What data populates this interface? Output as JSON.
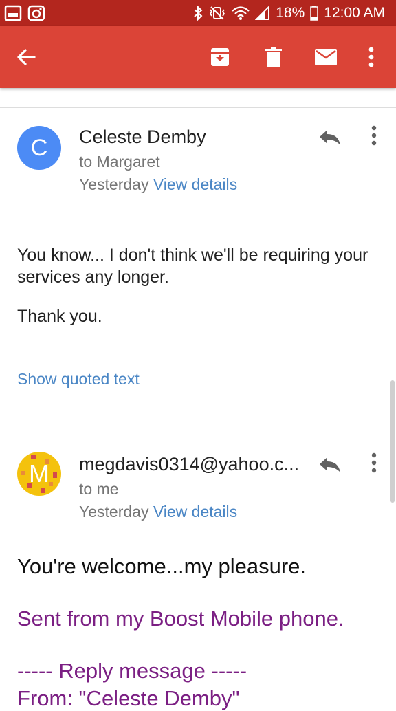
{
  "status_bar": {
    "battery": "18%",
    "time": "12:00 AM"
  },
  "toolbar": {
    "back_icon": "arrow-left",
    "archive_icon": "archive-box",
    "delete_icon": "trash-can",
    "mark_unread_icon": "envelope",
    "more_icon": "vertical-dots"
  },
  "messages": [
    {
      "avatar_letter": "C",
      "avatar_color": "#4c8bf5",
      "sender": "Celeste Demby",
      "recipient": "to Margaret",
      "date": "Yesterday",
      "details_link": "View details",
      "body": [
        "You know... I don't think we'll be requiring your services any longer.",
        "Thank you."
      ],
      "show_quoted": "Show quoted text"
    },
    {
      "avatar_letter": "M",
      "avatar_color": "#f4c20d",
      "sender": "megdavis0314@yahoo.c...",
      "recipient": "to me",
      "date": "Yesterday",
      "details_link": "View details",
      "body": [
        "You're welcome...my pleasure.",
        "Sent from my Boost Mobile phone.",
        "----- Reply message -----",
        "From: \"Celeste Demby\""
      ]
    }
  ],
  "colors": {
    "status_bar": "#b3261e",
    "toolbar": "#db4437",
    "link": "#4a86c5",
    "signature": "#7b1f83"
  }
}
